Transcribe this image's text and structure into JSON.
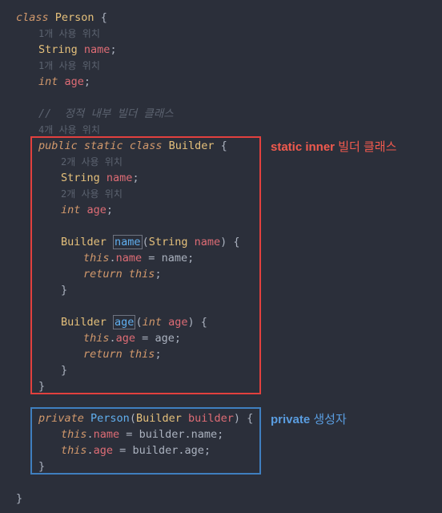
{
  "code": {
    "l1a": "class",
    "l1b": "Person",
    "l1c": " {",
    "l2": "1개 사용 위치",
    "l3a": "String",
    "l3b": "name",
    "l3c": ";",
    "l4": "1개 사용 위치",
    "l5a": "int",
    "l5b": "age",
    "l5c": ";",
    "l6": "//  정적 내부 빌더 클래스",
    "l7": "4개 사용 위치",
    "l8a": "public",
    "l8b": "static",
    "l8c": "class",
    "l8d": "Builder",
    "l8e": " {",
    "l9": "2개 사용 위치",
    "l10a": "String",
    "l10b": "name",
    "l10c": ";",
    "l11": "2개 사용 위치",
    "l12a": "int",
    "l12b": "age",
    "l12c": ";",
    "l13a": "Builder",
    "l13b": "name",
    "l13c": "(",
    "l13d": "String",
    "l13e": "name",
    "l13f": ") {",
    "l14a": "this",
    "l14b": ".",
    "l14c": "name",
    "l14d": " = ",
    "l14e": "name",
    "l14f": ";",
    "l15a": "return",
    "l15b": "this",
    "l15c": ";",
    "l16": "}",
    "l17a": "Builder",
    "l17b": "age",
    "l17c": "(",
    "l17d": "int",
    "l17e": "age",
    "l17f": ") {",
    "l18a": "this",
    "l18b": ".",
    "l18c": "age",
    "l18d": " = ",
    "l18e": "age",
    "l18f": ";",
    "l19a": "return",
    "l19b": "this",
    "l19c": ";",
    "l20": "}",
    "l21": "}",
    "l22a": "private",
    "l22b": "Person",
    "l22c": "(",
    "l22d": "Builder",
    "l22e": "builder",
    "l22f": ") {",
    "l23a": "this",
    "l23b": ".",
    "l23c": "name",
    "l23d": " = ",
    "l23e": "builder",
    "l23f": ".",
    "l23g": "name",
    "l23h": ";",
    "l24a": "this",
    "l24b": ".",
    "l24c": "age",
    "l24d": " = ",
    "l24e": "builder",
    "l24f": ".",
    "l24g": "age",
    "l24h": ";",
    "l25": "}",
    "l26": "}"
  },
  "anno": {
    "red_bold": "static inner",
    "red_tail": " 빌더 클래스",
    "blue_bold": "private",
    "blue_tail": " 생성자"
  }
}
